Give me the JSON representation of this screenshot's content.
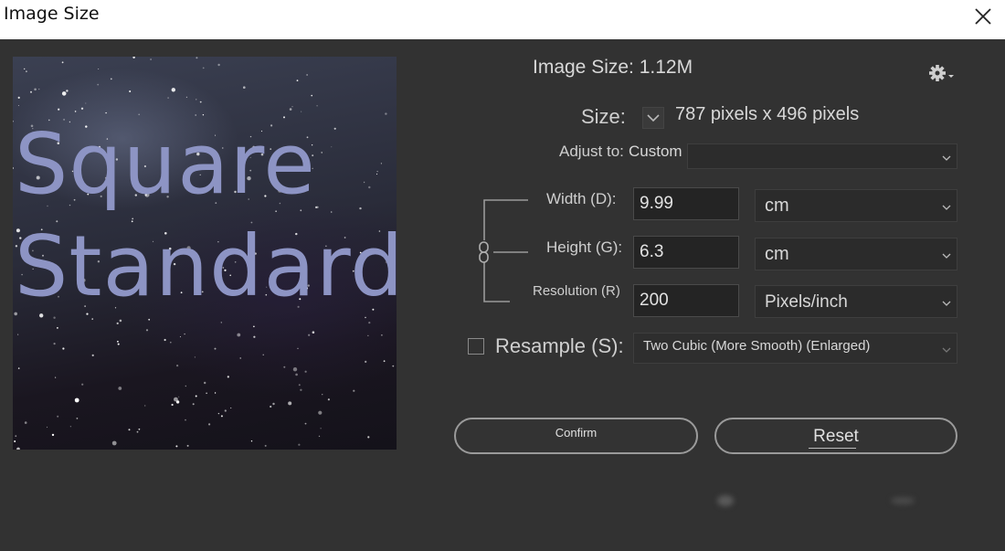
{
  "window": {
    "title": "Image Size"
  },
  "preview": {
    "overlay_lines": [
      "Square",
      "Standard"
    ]
  },
  "info": {
    "image_size": "Image Size: 1.12M"
  },
  "size": {
    "label": "Size:",
    "value": "787 pixels x 496 pixels"
  },
  "adjust": {
    "label": "Adjust to:",
    "value": "Custom"
  },
  "width": {
    "label": "Width (D):",
    "value": "9.99",
    "unit": "cm"
  },
  "height": {
    "label": "Height (G):",
    "value": "6.3",
    "unit": "cm"
  },
  "resolution": {
    "label": "Resolution (R)",
    "value": "200",
    "unit": "Pixels/inch"
  },
  "resample": {
    "label": "Resample (S):",
    "checked": false,
    "method": "Two Cubic (More Smooth) (Enlarged)"
  },
  "buttons": {
    "confirm": "Confirm",
    "reset": "Reset"
  },
  "icons": {
    "close": "close-icon",
    "gear": "gear-icon",
    "chevron": "chevron-down-icon",
    "link": "link-icon"
  }
}
